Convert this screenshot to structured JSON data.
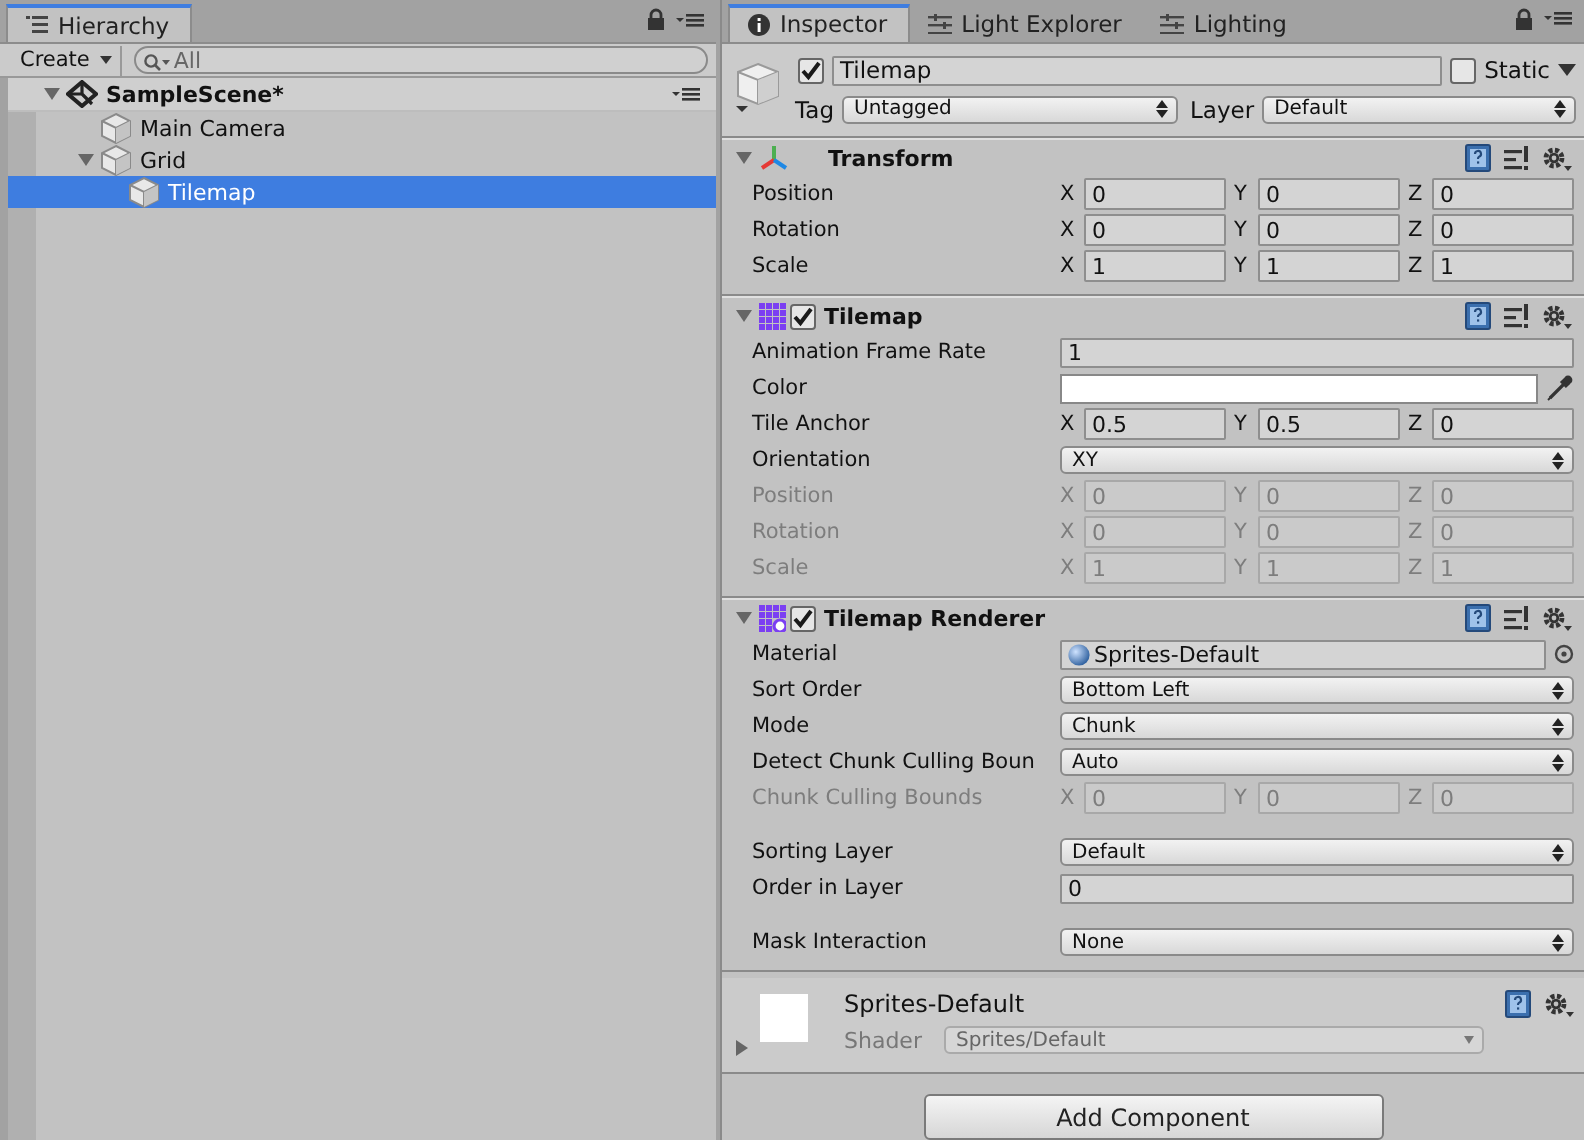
{
  "hierarchy": {
    "tab": {
      "label": "Hierarchy",
      "selected": true
    },
    "create": "Create",
    "search_placeholder": "All",
    "scene": {
      "name": "SampleScene*",
      "expanded": true,
      "children": [
        {
          "label": "Main Camera",
          "selected": false
        },
        {
          "label": "Grid",
          "selected": false,
          "expanded": true,
          "children": [
            {
              "label": "Tilemap",
              "selected": true
            }
          ]
        }
      ]
    }
  },
  "inspector": {
    "tabs": [
      {
        "label": "Inspector",
        "kind": "info",
        "selected": true
      },
      {
        "label": "Light Explorer",
        "kind": "sliders",
        "selected": false
      },
      {
        "label": "Lighting",
        "kind": "sliders",
        "selected": false
      }
    ],
    "object": {
      "name": "Tilemap",
      "active": true,
      "static_label": "Static",
      "static": false,
      "tag_label": "Tag",
      "tag": "Untagged",
      "layer_label": "Layer",
      "layer": "Default"
    },
    "components": [
      {
        "title": "Transform",
        "kind": "transform",
        "expanded": true,
        "rows": [
          {
            "kind": "vector",
            "label": "Position",
            "disabled": false,
            "fields": [
              {
                "axis": "X",
                "value": "0"
              },
              {
                "axis": "Y",
                "value": "0"
              },
              {
                "axis": "Z",
                "value": "0"
              }
            ]
          },
          {
            "kind": "vector",
            "label": "Rotation",
            "disabled": false,
            "fields": [
              {
                "axis": "X",
                "value": "0"
              },
              {
                "axis": "Y",
                "value": "0"
              },
              {
                "axis": "Z",
                "value": "0"
              }
            ]
          },
          {
            "kind": "vector",
            "label": "Scale",
            "disabled": false,
            "fields": [
              {
                "axis": "X",
                "value": "1"
              },
              {
                "axis": "Y",
                "value": "1"
              },
              {
                "axis": "Z",
                "value": "1"
              }
            ]
          }
        ]
      },
      {
        "title": "Tilemap",
        "kind": "tilemap",
        "enabled": true,
        "expanded": true,
        "rows": [
          {
            "kind": "text",
            "label": "Animation Frame Rate",
            "value": "1"
          },
          {
            "kind": "color",
            "label": "Color"
          },
          {
            "kind": "vector",
            "label": "Tile Anchor",
            "disabled": false,
            "fields": [
              {
                "axis": "X",
                "value": "0.5"
              },
              {
                "axis": "Y",
                "value": "0.5"
              },
              {
                "axis": "Z",
                "value": "0"
              }
            ]
          },
          {
            "kind": "dropdown",
            "label": "Orientation",
            "value": "XY"
          },
          {
            "kind": "vector",
            "label": "Position",
            "disabled": true,
            "fields": [
              {
                "axis": "X",
                "value": "0"
              },
              {
                "axis": "Y",
                "value": "0"
              },
              {
                "axis": "Z",
                "value": "0"
              }
            ]
          },
          {
            "kind": "vector",
            "label": "Rotation",
            "disabled": true,
            "fields": [
              {
                "axis": "X",
                "value": "0"
              },
              {
                "axis": "Y",
                "value": "0"
              },
              {
                "axis": "Z",
                "value": "0"
              }
            ]
          },
          {
            "kind": "vector",
            "label": "Scale",
            "disabled": true,
            "fields": [
              {
                "axis": "X",
                "value": "1"
              },
              {
                "axis": "Y",
                "value": "1"
              },
              {
                "axis": "Z",
                "value": "1"
              }
            ]
          }
        ]
      },
      {
        "title": "Tilemap Renderer",
        "kind": "renderer",
        "enabled": true,
        "expanded": true,
        "rows": [
          {
            "kind": "object",
            "label": "Material",
            "value": "Sprites-Default"
          },
          {
            "kind": "dropdown",
            "label": "Sort Order",
            "value": "Bottom Left"
          },
          {
            "kind": "dropdown",
            "label": "Mode",
            "value": "Chunk"
          },
          {
            "kind": "dropdown",
            "label": "Detect Chunk Culling Boun",
            "value": "Auto"
          },
          {
            "kind": "vector",
            "label": "Chunk Culling Bounds",
            "disabled": true,
            "fields": [
              {
                "axis": "X",
                "value": "0"
              },
              {
                "axis": "Y",
                "value": "0"
              },
              {
                "axis": "Z",
                "value": "0"
              }
            ]
          },
          {
            "kind": "gap"
          },
          {
            "kind": "dropdown",
            "label": "Sorting Layer",
            "value": "Default"
          },
          {
            "kind": "text",
            "label": "Order in Layer",
            "value": "0"
          },
          {
            "kind": "gap"
          },
          {
            "kind": "dropdown",
            "label": "Mask Interaction",
            "value": "None"
          }
        ]
      }
    ],
    "material": {
      "name": "Sprites-Default",
      "expanded": false,
      "shader_label": "Shader",
      "shader": "Sprites/Default"
    },
    "add_component": "Add Component"
  }
}
